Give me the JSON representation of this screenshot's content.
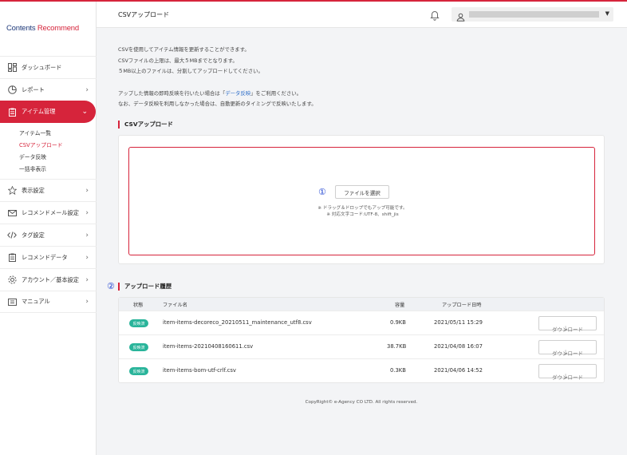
{
  "logo": {
    "part1": "Contents",
    "part2": "Recommend"
  },
  "sidebar": {
    "items": [
      {
        "label": "ダッシュボード"
      },
      {
        "label": "レポート",
        "chevron": "›"
      },
      {
        "label": "アイテム管理",
        "chevron": "⌄"
      },
      {
        "label": "表示設定",
        "chevron": "›"
      },
      {
        "label": "レコメンドメール設定",
        "chevron": "›"
      },
      {
        "label": "タグ設定",
        "chevron": "›"
      },
      {
        "label": "レコメンドデータ",
        "chevron": "›"
      },
      {
        "label": "アカウント／基本設定",
        "chevron": "›"
      },
      {
        "label": "マニュアル",
        "chevron": "›"
      }
    ],
    "sub_items": [
      "アイテム一覧",
      "CSVアップロード",
      "データ反映",
      "一括非表示"
    ]
  },
  "header": {
    "title": "CSVアップロード"
  },
  "info": {
    "line1": "CSVを使用してアイテム情報を更新することができます。",
    "line2": "CSVファイルの上限は、最大５MBまでとなります。",
    "line3": "５MB以上のファイルは、分割してアップロードしてください。",
    "line4_pre": "アップした情報の即時反映を行いたい場合は「",
    "line4_link": "データ反映",
    "line4_post": "」をご利用ください。",
    "line5": "なお、データ反映を利用しなかった場合は、自動更新のタイミングで反映いたします。"
  },
  "upload": {
    "section_title": "CSVアップロード",
    "marker": "①",
    "select_button": "ファイルを選択",
    "note1": "※ ドラッグ＆ドロップでもアップ可能です。",
    "note2": "※ 対応文字コード:UTF-8、shift_jis"
  },
  "history": {
    "marker": "②",
    "section_title": "アップロード履歴",
    "columns": {
      "status": "状態",
      "file": "ファイル名",
      "size": "容量",
      "date": "アップロード日時"
    },
    "rows": [
      {
        "status": "反映済",
        "file": "item-items-decoreco_20210511_maintenance_utf8.csv",
        "size": "0.9KB",
        "date": "2021/05/11 15:29",
        "button": "ダウンロード"
      },
      {
        "status": "反映済",
        "file": "item-items-20210408160611.csv",
        "size": "38.7KB",
        "date": "2021/04/08 16:07",
        "button": "ダウンロード"
      },
      {
        "status": "反映済",
        "file": "item-items-bom-utf-crlf.csv",
        "size": "0.3KB",
        "date": "2021/04/06 14:52",
        "button": "ダウンロード"
      }
    ]
  },
  "footer": {
    "copyright": "CopyRight© e-Agency CO LTD. All rights reserved."
  },
  "colors": {
    "accent": "#d6243b",
    "badge": "#29b49a",
    "marker": "#1a3fd0",
    "link": "#2f6fc9"
  }
}
